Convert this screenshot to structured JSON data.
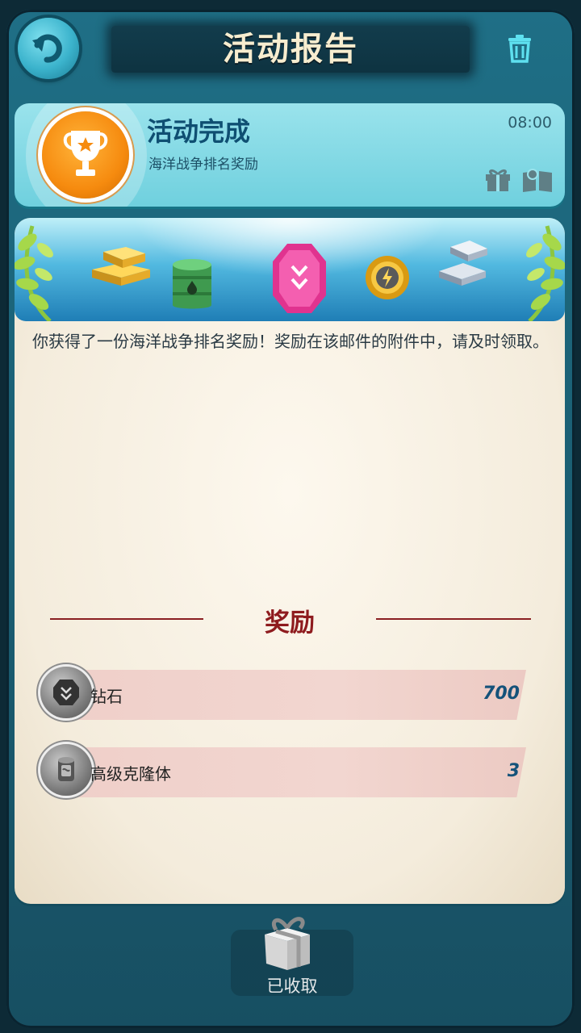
{
  "header": {
    "title": "活动报告"
  },
  "mail": {
    "title": "活动完成",
    "subtitle": "海洋战争排名奖励",
    "time": "08:00",
    "body": "你获得了一份海洋战争排名奖励！奖励在该邮件的附件中，请及时领取。"
  },
  "rewards": {
    "section_title": "奖励",
    "items": [
      {
        "name": "钻石",
        "count": "700",
        "icon": "diamond-icon"
      },
      {
        "name": "高级克隆体",
        "count": "3",
        "icon": "clone-canister-icon"
      }
    ]
  },
  "footer": {
    "claim_label": "已收取"
  },
  "colors": {
    "accent_teal": "#1f6f86",
    "reward_title_red": "#8e1b1e",
    "count_blue": "#14527a",
    "trophy_orange": "#f68b0f"
  }
}
